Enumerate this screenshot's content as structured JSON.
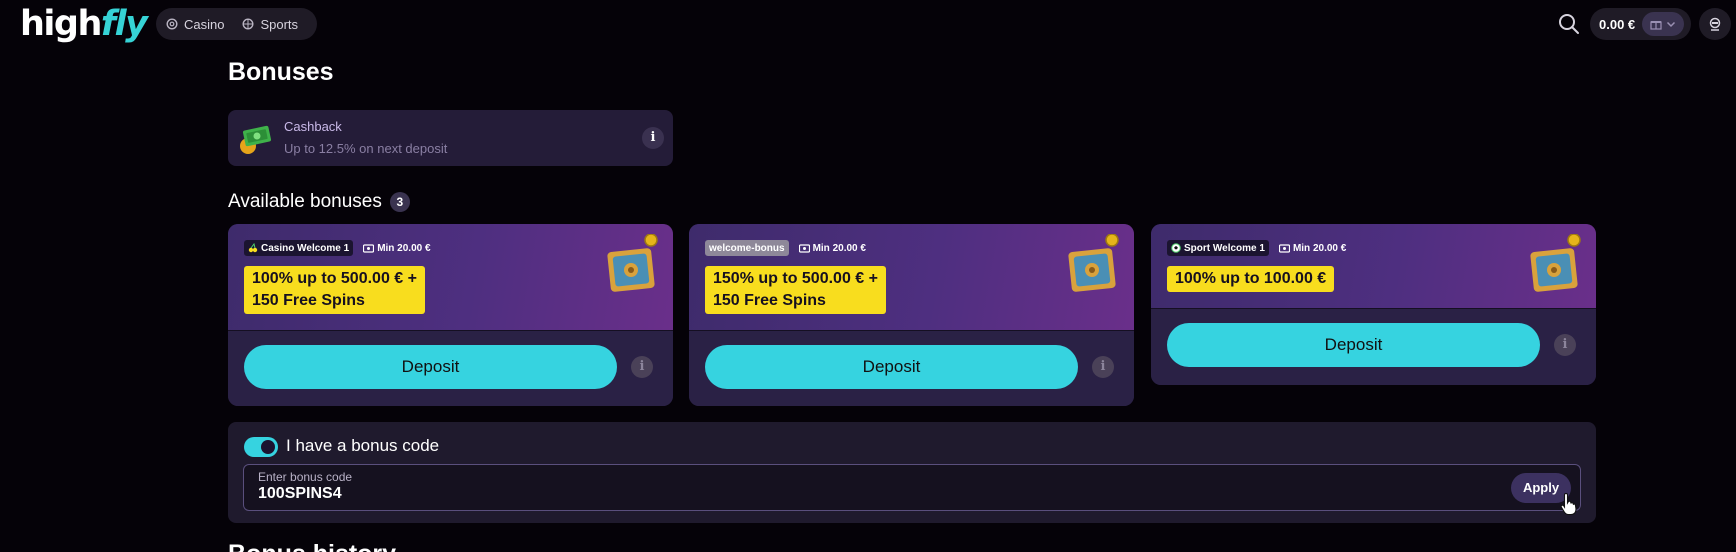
{
  "header": {
    "logo_high": "high",
    "logo_fly": "fly",
    "nav": [
      {
        "label": "Casino",
        "icon": "casino-chip-icon"
      },
      {
        "label": "Sports",
        "icon": "sports-ball-icon"
      }
    ],
    "balance": "0.00 €"
  },
  "page": {
    "title": "Bonuses",
    "next_heading": "Bonus history"
  },
  "cashback": {
    "title": "Cashback",
    "subtitle": "Up to 12.5% on next deposit",
    "info": "i"
  },
  "available": {
    "title": "Available bonuses",
    "count": "3",
    "cards": [
      {
        "tag": "Casino Welcome 1",
        "min": "Min 20.00 €",
        "offer_line1": "100% up to 500.00 € +",
        "offer_line2": "150 Free Spins",
        "button": "Deposit",
        "info": "i"
      },
      {
        "tag": "welcome-bonus",
        "min": "Min 20.00 €",
        "offer_line1": "150% up to 500.00 € +",
        "offer_line2": "150 Free Spins",
        "button": "Deposit",
        "info": "i"
      },
      {
        "tag": "Sport Welcome 1",
        "min": "Min 20.00 €",
        "offer_line1": "100% up to 100.00 €",
        "button": "Deposit",
        "info": "i"
      }
    ]
  },
  "bonus_code": {
    "toggle_label": "I have a bonus code",
    "toggle_on": true,
    "input_label": "Enter bonus code",
    "input_value": "100SPINS4",
    "apply": "Apply"
  },
  "colors": {
    "accent": "#36d3e0",
    "offer_bg": "#f8dd1e",
    "card_bg": "#2a2145"
  }
}
